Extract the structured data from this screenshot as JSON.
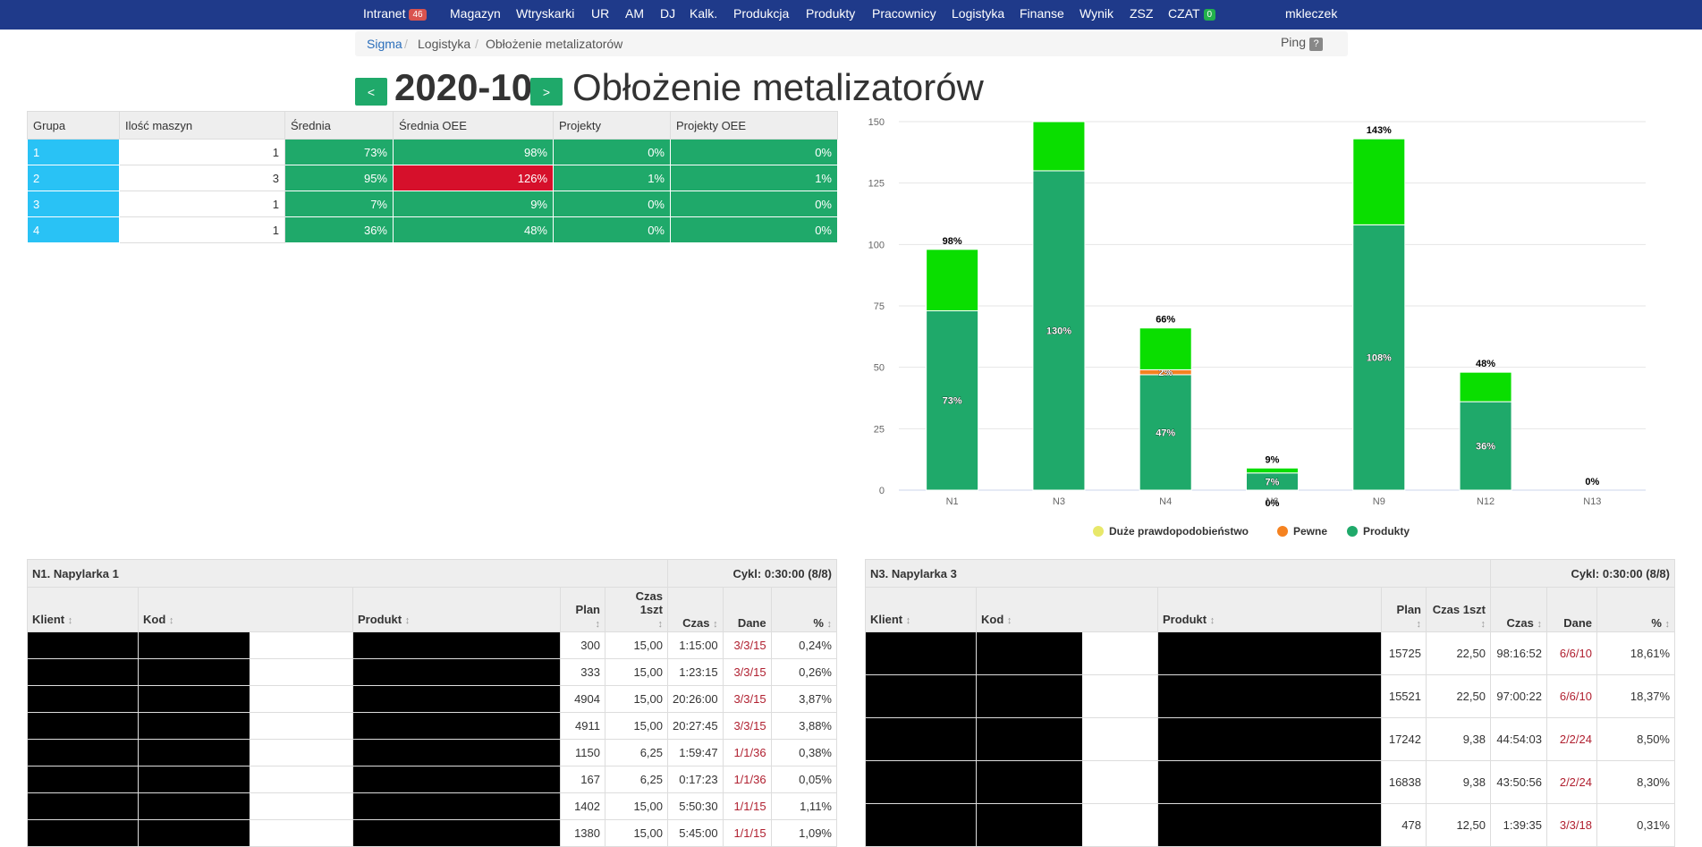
{
  "nav": {
    "items": [
      {
        "label": "Intranet",
        "badge": "46",
        "badge_color": "#d9534f"
      },
      {
        "label": "Magazyn"
      },
      {
        "label": "Wtryskarki"
      },
      {
        "label": "UR"
      },
      {
        "label": "AM"
      },
      {
        "label": "DJ"
      },
      {
        "label": "Kalk."
      },
      {
        "label": "Produkcja"
      },
      {
        "label": "Produkty"
      },
      {
        "label": "Pracownicy"
      },
      {
        "label": "Logistyka"
      },
      {
        "label": "Finanse"
      },
      {
        "label": "Wynik"
      },
      {
        "label": "ZSZ"
      },
      {
        "label": "CZAT",
        "badge": "0",
        "badge_color": "#22b14c"
      }
    ],
    "user": "mkleczek",
    "bg_color": "#1f3a8a"
  },
  "breadcrumb": {
    "items": [
      "Sigma",
      "Logistyka",
      "Obłożenie metalizatorów"
    ],
    "ping": "Ping",
    "help": "?"
  },
  "title": {
    "prev": "<",
    "next": ">",
    "month": "2020-10",
    "text": "Obłożenie metalizatorów"
  },
  "summary": {
    "headers": [
      "Grupa",
      "Ilość maszyn",
      "Średnia",
      "Średnia OEE",
      "Projekty",
      "Projekty OEE"
    ],
    "rows": [
      [
        "1",
        "1",
        "73%",
        "98%",
        "0%",
        "0%"
      ],
      [
        "2",
        "3",
        "95%",
        "126%",
        "1%",
        "1%"
      ],
      [
        "3",
        "1",
        "7%",
        "9%",
        "0%",
        "0%"
      ],
      [
        "4",
        "1",
        "36%",
        "48%",
        "0%",
        "0%"
      ]
    ]
  },
  "chart_data": {
    "type": "bar",
    "stacked": true,
    "categories": [
      "N1",
      "N3",
      "N4",
      "N6",
      "N9",
      "N12",
      "N13"
    ],
    "series": [
      {
        "name": "Produkty",
        "color": "#1fa96a",
        "values": [
          73,
          130,
          47,
          7,
          108,
          36,
          0
        ],
        "labels": [
          "73%",
          "130%",
          "47%",
          "7%",
          "108%",
          "36%",
          ""
        ]
      },
      {
        "name": "Pewne",
        "color": "#f58220",
        "values": [
          0,
          0,
          2,
          0,
          0,
          0,
          0
        ],
        "labels": [
          "",
          "",
          "2%",
          "",
          "",
          "",
          ""
        ]
      },
      {
        "name": "Duże prawdopodobieństwo",
        "color": "#e8e86a",
        "values": [
          0,
          0,
          0,
          0,
          0,
          0,
          0
        ],
        "labels": [
          "",
          "",
          "",
          "",
          "",
          "",
          ""
        ]
      },
      {
        "name": "",
        "color": "#0ade00",
        "values": [
          25,
          20,
          17,
          2,
          35,
          12,
          0
        ],
        "labels": [
          "",
          "",
          "",
          "",
          "",
          "",
          ""
        ]
      }
    ],
    "totals": [
      "98%",
      "",
      "66%",
      "9%",
      "143%",
      "48%",
      "0%"
    ],
    "extra_label": {
      "index": 3,
      "text": "0%"
    },
    "yticks": [
      0,
      25,
      50,
      75,
      100,
      125,
      150
    ],
    "ylim": [
      0,
      150
    ],
    "legend": [
      {
        "name": "Duże prawdopodobieństwo",
        "color": "#e8e86a"
      },
      {
        "name": "Pewne",
        "color": "#f58220"
      },
      {
        "name": "Produkty",
        "color": "#1fa96a"
      }
    ],
    "legend_position": "bottom",
    "grid": true
  },
  "panels": [
    {
      "title": "N1. Napylarka 1",
      "cycle": "Cykl: 0:30:00 (8/8)",
      "headers": [
        "Klient",
        "Kod",
        "Produkt",
        "Plan",
        "Czas 1szt",
        "Czas",
        "Dane",
        "%"
      ],
      "rows": [
        {
          "plan": "300",
          "czas1": "15,00",
          "czas": "1:15:00",
          "dane": "3/3/15",
          "pct": "0,24%"
        },
        {
          "plan": "333",
          "czas1": "15,00",
          "czas": "1:23:15",
          "dane": "3/3/15",
          "pct": "0,26%"
        },
        {
          "plan": "4904",
          "czas1": "15,00",
          "czas": "20:26:00",
          "dane": "3/3/15",
          "pct": "3,87%"
        },
        {
          "plan": "4911",
          "czas1": "15,00",
          "czas": "20:27:45",
          "dane": "3/3/15",
          "pct": "3,88%"
        },
        {
          "plan": "1150",
          "czas1": "6,25",
          "czas": "1:59:47",
          "dane": "1/1/36",
          "pct": "0,38%"
        },
        {
          "plan": "167",
          "czas1": "6,25",
          "czas": "0:17:23",
          "dane": "1/1/36",
          "pct": "0,05%"
        },
        {
          "plan": "1402",
          "czas1": "15,00",
          "czas": "5:50:30",
          "dane": "1/1/15",
          "pct": "1,11%"
        },
        {
          "plan": "1380",
          "czas1": "15,00",
          "czas": "5:45:00",
          "dane": "1/1/15",
          "pct": "1,09%"
        }
      ]
    },
    {
      "title": "N3. Napylarka 3",
      "cycle": "Cykl: 0:30:00 (8/8)",
      "headers": [
        "Klient",
        "Kod",
        "Produkt",
        "Plan",
        "Czas 1szt",
        "Czas",
        "Dane",
        "%"
      ],
      "rows": [
        {
          "plan": "15725",
          "czas1": "22,50",
          "czas": "98:16:52",
          "dane": "6/6/10",
          "pct": "18,61%"
        },
        {
          "plan": "15521",
          "czas1": "22,50",
          "czas": "97:00:22",
          "dane": "6/6/10",
          "pct": "18,37%"
        },
        {
          "plan": "17242",
          "czas1": "9,38",
          "czas": "44:54:03",
          "dane": "2/2/24",
          "pct": "8,50%"
        },
        {
          "plan": "16838",
          "czas1": "9,38",
          "czas": "43:50:56",
          "dane": "2/2/24",
          "pct": "8,30%"
        },
        {
          "plan": "478",
          "czas1": "12,50",
          "czas": "1:39:35",
          "dane": "3/3/18",
          "pct": "0,31%"
        }
      ]
    }
  ]
}
